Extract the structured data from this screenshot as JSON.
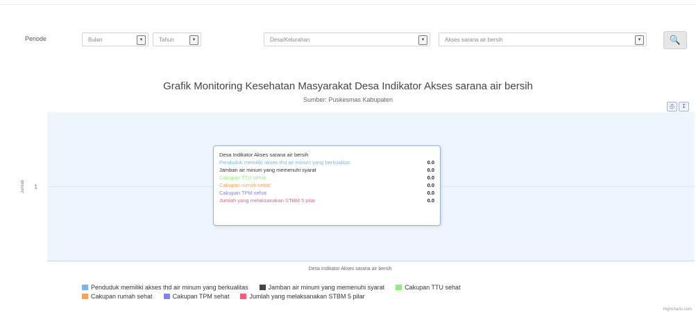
{
  "filters": {
    "periode_label": "Periode",
    "bulan_value": "Bulan",
    "tahun_value": "Tahun",
    "desa_value": "Desa/Kelurahan",
    "indikator_value": "Akses sarana air bersih"
  },
  "colors": {
    "plot_bg": "#eef5fc",
    "accent": "#4a6fa5"
  },
  "chart_data": {
    "type": "bar",
    "title": "Grafik Monitoring Kesehatan Masyarakat Desa Indikator Akses sarana air bersih",
    "subtitle": "Sumber: Puskesmas Kabupaten",
    "xlabel": "Desa Indikator Akses sarana air bersih",
    "ylabel": "Jumlah",
    "ylim": [
      0,
      2
    ],
    "yticks": [
      1
    ],
    "grid": true,
    "legend_position": "bottom",
    "categories": [
      "Desa Indikator Akses sarana air bersih"
    ],
    "series": [
      {
        "name": "Penduduk memiliki akses thd air minum yang berkualitas",
        "color": "#7cb5ec",
        "values": [
          0
        ]
      },
      {
        "name": "Jamban air minum yang memenuhi syarat",
        "color": "#434348",
        "values": [
          0
        ]
      },
      {
        "name": "Cakupan TTU sehat",
        "color": "#90ed7d",
        "values": [
          0
        ]
      },
      {
        "name": "Cakupan rumah sehat",
        "color": "#f7a35c",
        "values": [
          0
        ]
      },
      {
        "name": "Cakupan TPM sehat",
        "color": "#8085e9",
        "values": [
          0
        ]
      },
      {
        "name": "Jumlah yang melaksanakan STBM 5 pilar",
        "color": "#f15c80",
        "values": [
          0
        ]
      }
    ]
  },
  "tooltip": {
    "header": "Desa Indikator Akses sarana air bersih",
    "value_text": "0.0"
  },
  "credit": "Highcharts.com"
}
